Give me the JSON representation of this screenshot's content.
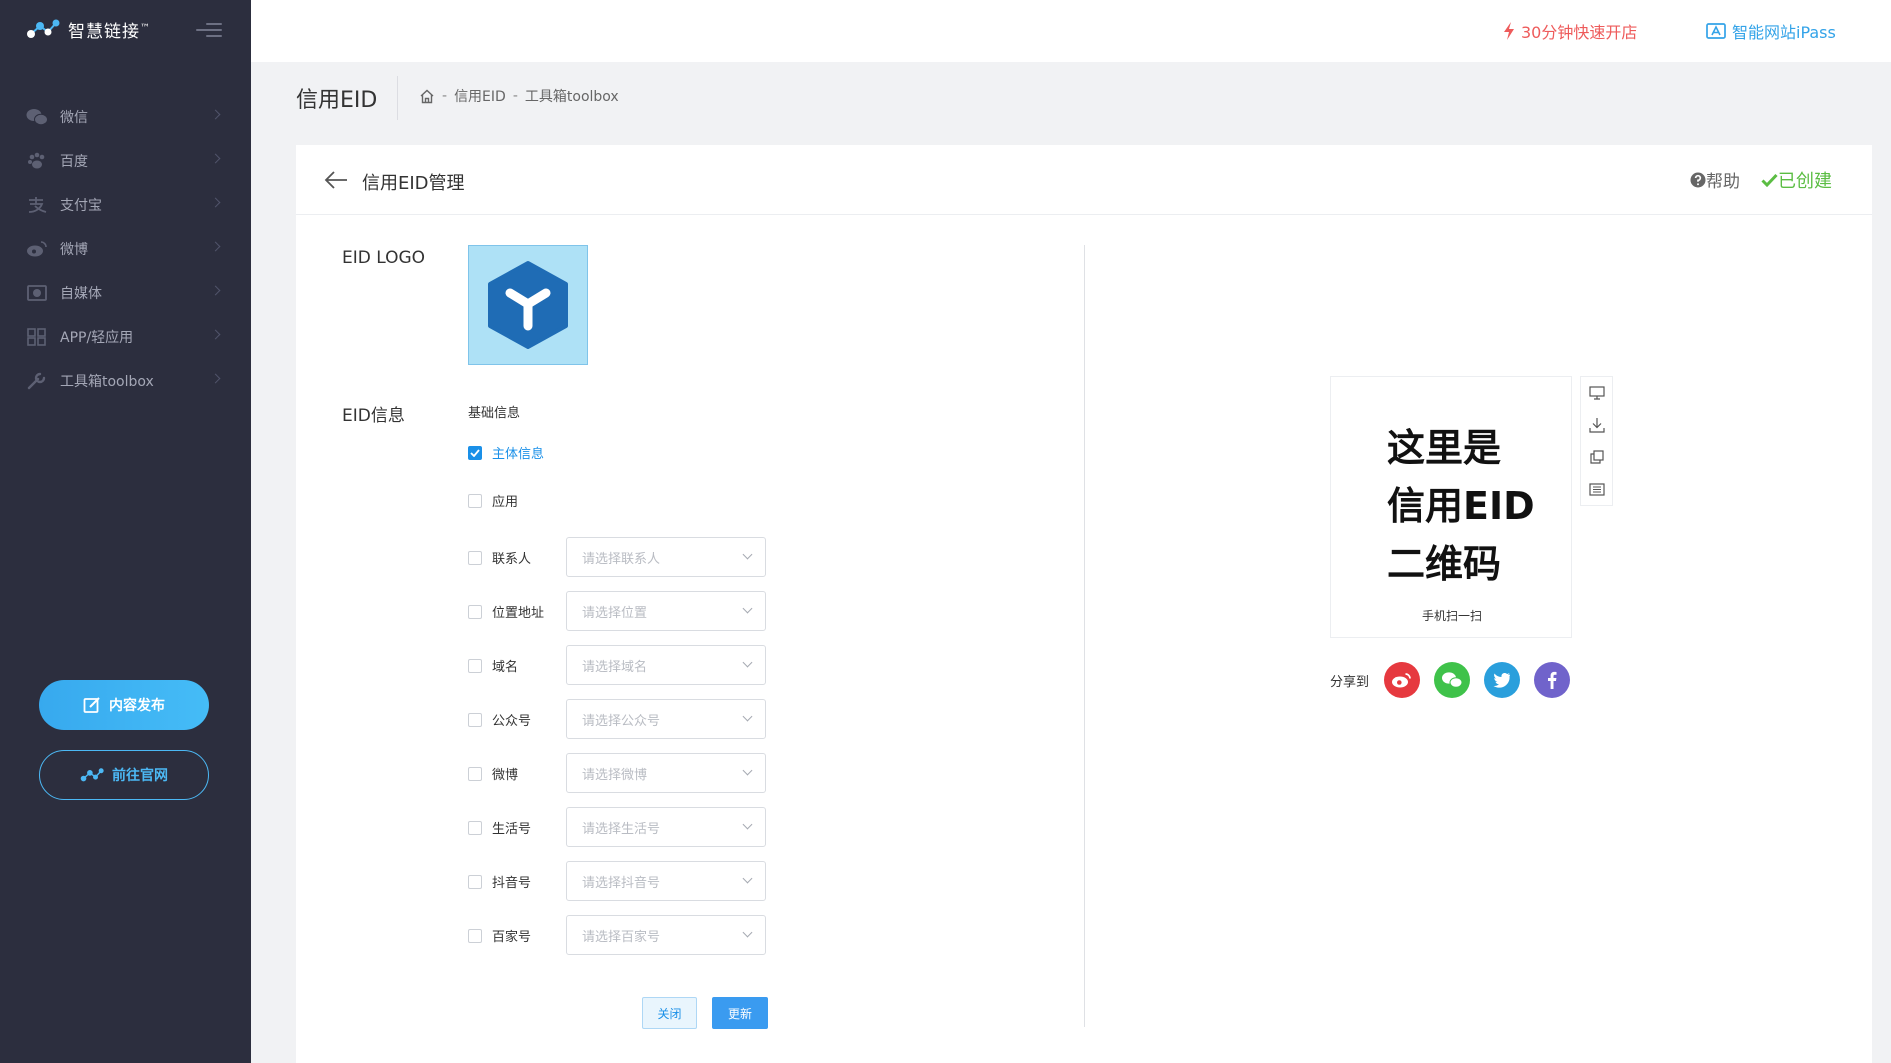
{
  "brand": {
    "name": "智慧链接",
    "tm": "™"
  },
  "sidebar": {
    "items": [
      {
        "label": "微信",
        "icon": "wechat-icon"
      },
      {
        "label": "百度",
        "icon": "paw-icon"
      },
      {
        "label": "支付宝",
        "icon": "alipay-icon"
      },
      {
        "label": "微博",
        "icon": "weibo-icon"
      },
      {
        "label": "自媒体",
        "icon": "media-icon"
      },
      {
        "label": "APP/轻应用",
        "icon": "apps-icon"
      },
      {
        "label": "工具箱toolbox",
        "icon": "wrench-icon"
      }
    ],
    "publish_label": "内容发布",
    "site_label": "前往官网"
  },
  "topbar": {
    "quick_label": "30分钟快速开店",
    "ipass_label": "智能网站iPass"
  },
  "header": {
    "title": "信用EID",
    "breadcrumb": [
      "信用EID",
      "工具箱toolbox"
    ],
    "sep": "-"
  },
  "card": {
    "title": "信用EID管理",
    "help_label": "帮助",
    "created_label": "已创建",
    "logo_label": "EID LOGO",
    "info_label": "EID信息",
    "section_label": "基础信息",
    "options": [
      {
        "label": "主体信息",
        "checked": true
      },
      {
        "label": "应用",
        "checked": false
      }
    ],
    "fields": [
      {
        "label": "联系人",
        "placeholder": "请选择联系人"
      },
      {
        "label": "位置地址",
        "placeholder": "请选择位置"
      },
      {
        "label": "域名",
        "placeholder": "请选择域名"
      },
      {
        "label": "公众号",
        "placeholder": "请选择公众号"
      },
      {
        "label": "微博",
        "placeholder": "请选择微博"
      },
      {
        "label": "生活号",
        "placeholder": "请选择生活号"
      },
      {
        "label": "抖音号",
        "placeholder": "请选择抖音号"
      },
      {
        "label": "百家号",
        "placeholder": "请选择百家号"
      }
    ],
    "close_label": "关闭",
    "update_label": "更新"
  },
  "qr": {
    "lines": [
      "这里是",
      "信用EID",
      "二维码"
    ],
    "caption": "手机扫一扫",
    "share_label": "分享到"
  },
  "colors": {
    "sidebar_bg": "#2c2e3e",
    "accent": "#1a90e8",
    "quick": "#ee5b5b",
    "created": "#5bbd43",
    "weibo": "#e6393f",
    "wechat": "#3fc24a",
    "twitter": "#2a9fdc",
    "facebook": "#7063cb"
  }
}
